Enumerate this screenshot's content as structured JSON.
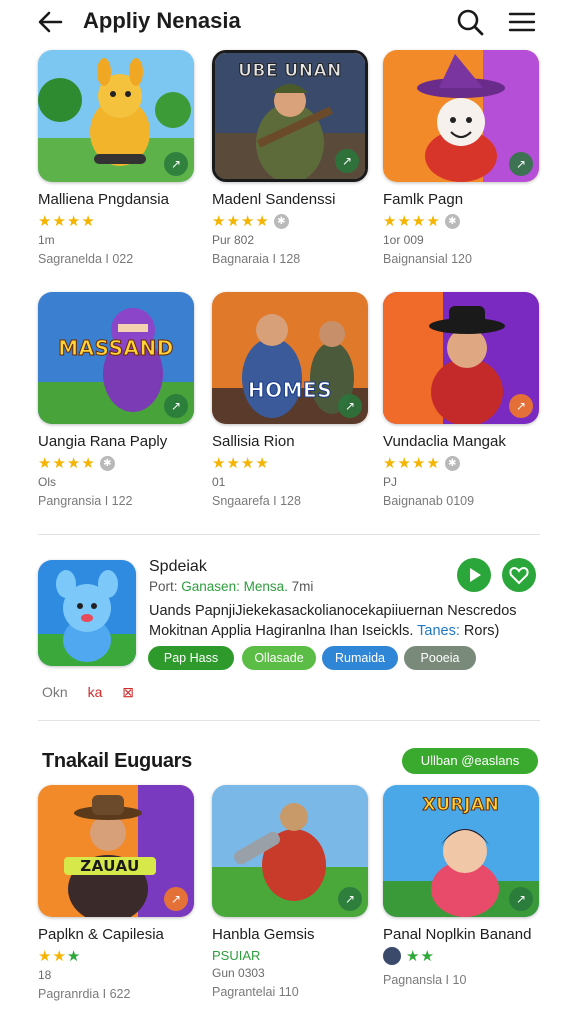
{
  "header": {
    "title": "Appliy Nenasia",
    "back_icon": "arrow-left-icon",
    "search_icon": "search-icon",
    "menu_icon": "hamburger-menu-icon"
  },
  "grid1": [
    {
      "title": "Malliena Pngdansia",
      "stars": 4,
      "badge": false,
      "meta": "1m",
      "sub": "Sagranelda I 022",
      "art": "kangaroo"
    },
    {
      "title": "Madenl Sandenssi",
      "stars": 4,
      "badge": true,
      "meta": "Pur 802",
      "sub": "Bagnaraia I 128",
      "art": "soldier",
      "banner": "UBE UNAN"
    },
    {
      "title": "Famlk Pagn",
      "stars": 4,
      "badge": true,
      "meta": "1or 009",
      "sub": "Baignansial 120",
      "art": "wizard"
    },
    {
      "title": "Uangia Rana Paply",
      "stars": 4,
      "badge": true,
      "meta": "Ols",
      "sub": "Pangransia I 122",
      "art": "ninja",
      "banner": "MASSAND"
    },
    {
      "title": "Sallisia Rion",
      "stars": 4,
      "badge": false,
      "meta": "01",
      "sub": "Sngaarefa I 128",
      "art": "heroes",
      "banner": "HOMES"
    },
    {
      "title": "Vundaclia Mangak",
      "stars": 4,
      "badge": true,
      "meta": "PJ",
      "sub": "Baignanab 0109",
      "art": "cowboy"
    }
  ],
  "featured": {
    "name": "Spdeiak",
    "meta_prefix": "Port:",
    "meta_green": "Ganasen: Mensa.",
    "meta_suffix": "7mi",
    "desc_line1": "Uands PapnjiJiekekasackolianocekapiiuernan Nescredos",
    "desc_line2": "Mokitnan Applia Hagiranlna Ihan Iseickls.",
    "desc_blue": "Tanes:",
    "desc_tail": "Rors)",
    "chips": [
      {
        "label": "Pap Hass",
        "color": "#2f9a2c"
      },
      {
        "label": "Ollasade",
        "color": "#5bbd45"
      },
      {
        "label": "Rumaida",
        "color": "#2f86d6"
      },
      {
        "label": "Pooeia",
        "color": "#7a8a7a"
      }
    ],
    "rating_text": "Okn",
    "rating_red": "ka"
  },
  "section2": {
    "title": "Tnakail Euguars",
    "see_all": "Ullban @easlans"
  },
  "grid2": [
    {
      "title": "Paplkn & Capilesia",
      "stars": 3,
      "star_color": "mixed",
      "meta": "18",
      "sub": "Pagranrdia I 622",
      "art": "cowboy2",
      "banner": "ZAUAU"
    },
    {
      "title": "Hanbla Gemsis",
      "tag": "PSUIAR",
      "meta": "Gun 0303",
      "sub": "Pagrantelai 110",
      "art": "armor"
    },
    {
      "title": "Panal Noplkin Banand",
      "stars": 2,
      "star_color": "green",
      "avatar": true,
      "sub": "Pagnansla I 10",
      "art": "anime",
      "banner": "XURJAN"
    }
  ]
}
